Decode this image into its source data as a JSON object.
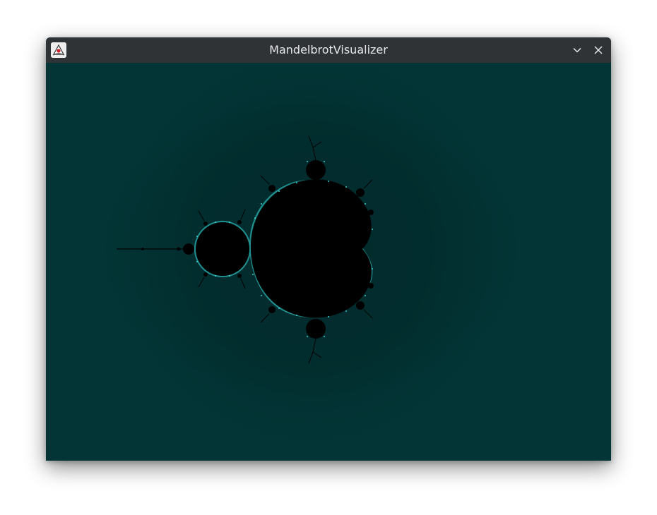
{
  "window": {
    "title": "MandelbrotVisualizer",
    "app_icon": "java-duke-icon",
    "controls": [
      "minimize-icon",
      "close-icon"
    ]
  },
  "canvas": {
    "content": "mandelbrot-fractal",
    "background_color": "#033536",
    "set_color": "#000000",
    "edge_color": "#3ee0e0"
  }
}
